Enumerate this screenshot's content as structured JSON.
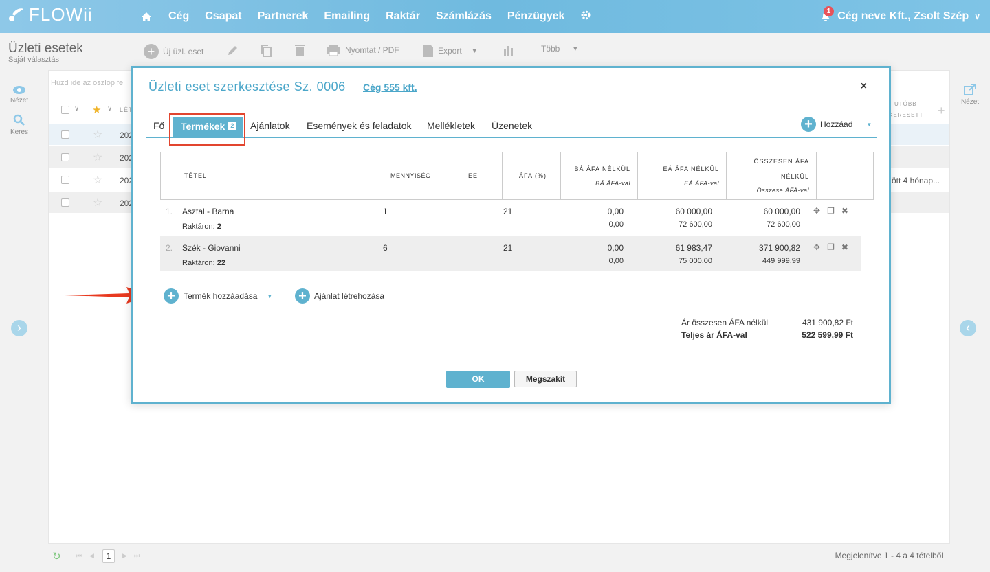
{
  "app": {
    "logo": "FLOWii",
    "nav": [
      "Cég",
      "Csapat",
      "Partnerek",
      "Emailing",
      "Raktár",
      "Számlázás",
      "Pénzügyek"
    ],
    "notifications": "1",
    "user": "Cég neve Kft., Zsolt Szép"
  },
  "page": {
    "title": "Üzleti esetek",
    "subtitle": "Saját választás"
  },
  "toolbar": {
    "new": "Új üzl. eset",
    "print": "Nyomtat / PDF",
    "export": "Export",
    "more": "Több"
  },
  "rail": {
    "view": "Nézet",
    "search": "Keres",
    "right_view": "Nézet"
  },
  "list": {
    "group_hint": "Húzd ide az oszlop fe",
    "col_partial": "LÉT",
    "right_col1": "UTÓBB",
    "right_col2": "KERESETT",
    "rows": [
      "202",
      "202",
      "202",
      "202"
    ],
    "row3_right": "ött  4 hónap..."
  },
  "footer": {
    "page": "1",
    "summary": "Megjelenítve 1 - 4 a 4 tételből"
  },
  "modal": {
    "title": "Üzleti eset szerkesztése Sz. 0006",
    "company_link": "Cég 555 kft.",
    "close": "×",
    "tabs": [
      "Fő",
      "Termékek",
      "Ajánlatok",
      "Események és feladatok",
      "Mellékletek",
      "Üzenetek"
    ],
    "tab_count": "2",
    "add_label": "Hozzáad",
    "table": {
      "headers": {
        "item": "TÉTEL",
        "qty": "MENNYISÉG",
        "unit": "EE",
        "vat": "ÁFA (%)",
        "ba1": "BÁ ÁFA NÉLKÜL",
        "ba2": "BÁ ÁFA-val",
        "ea1": "EÁ ÁFA NÉLKÜL",
        "ea2": "EÁ ÁFA-val",
        "tot1": "ÖSSZESEN ÁFA",
        "tot1b": "NÉLKÜL",
        "tot2": "Összese ÁFA-val"
      },
      "rows": [
        {
          "num": "1.",
          "name": "Asztal - Barna",
          "stock_label": "Raktáron:",
          "stock": "2",
          "qty": "1",
          "vat": "21",
          "ba": "0,00",
          "ba_vat": "0,00",
          "ea": "60 000,00",
          "ea_vat": "72 600,00",
          "tot": "60 000,00",
          "tot_vat": "72 600,00"
        },
        {
          "num": "2.",
          "name": "Szék - Giovanni",
          "stock_label": "Raktáron:",
          "stock": "22",
          "qty": "6",
          "vat": "21",
          "ba": "0,00",
          "ba_vat": "0,00",
          "ea": "61 983,47",
          "ea_vat": "75 000,00",
          "tot": "371 900,82",
          "tot_vat": "449 999,99"
        }
      ]
    },
    "add_product": "Termék hozzáadása",
    "create_offer": "Ajánlat létrehozása",
    "totals": {
      "net_label": "Ár összesen ÁFA nélkül",
      "net_value": "431 900,82 Ft",
      "gross_label": "Teljes ár ÁFA-val",
      "gross_value": "522 599,99 Ft"
    },
    "ok": "OK",
    "cancel": "Megszakít"
  }
}
